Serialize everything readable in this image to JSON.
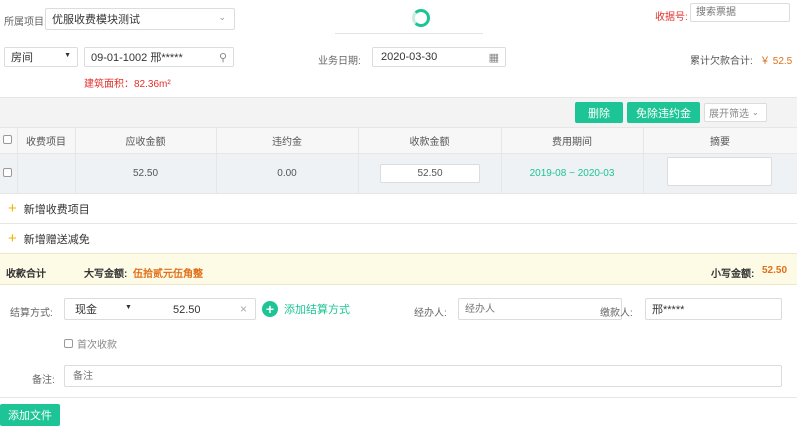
{
  "header": {
    "project_label": "所属项目:",
    "project_value": "优服收费模块测试",
    "receipt_label": "收据号:",
    "receipt_placeholder": "搜索票据"
  },
  "filter": {
    "room_type": "房间",
    "room_value": "09-01-1002 邢*****",
    "biz_date_label": "业务日期:",
    "biz_date_value": "2020-03-30",
    "arrears_label": "累计欠款合计:",
    "arrears_value": "￥ 52.5",
    "area_text": "建筑面积：82.36m²"
  },
  "toolbar": {
    "delete_label": "删除",
    "waive_label": "免除违约金",
    "expand_label": "展开筛选"
  },
  "table": {
    "headers": [
      "收费项目",
      "应收金额",
      "违约金",
      "收款金额",
      "费用期间",
      "摘要"
    ],
    "row": {
      "receivable": "52.50",
      "penalty": "0.00",
      "received": "52.50",
      "period": "2019-08 ~ 2020-03"
    }
  },
  "actions": {
    "add_item": "新增收费项目",
    "add_discount": "新增赠送减免"
  },
  "summary": {
    "total_label": "收款合计",
    "capital_label": "大写金额:",
    "capital_value": "伍拾贰元伍角整",
    "lower_label": "小写金额:",
    "lower_value": "52.50"
  },
  "payment": {
    "method_label": "结算方式:",
    "method_value": "现金",
    "amount": "52.50",
    "add_method": "添加结算方式",
    "handler_label": "经办人:",
    "handler_placeholder": "经办人",
    "payer_label": "缴款人:",
    "payer_value": "邢*****",
    "first_payment": "首次收款",
    "remark_label": "备注:",
    "remark_placeholder": "备注",
    "add_file": "添加文件"
  },
  "colors": {
    "accent": "#1dc495",
    "red": "#e0302b",
    "orange": "#e0701a",
    "summary_bg": "#fdfbe6"
  }
}
